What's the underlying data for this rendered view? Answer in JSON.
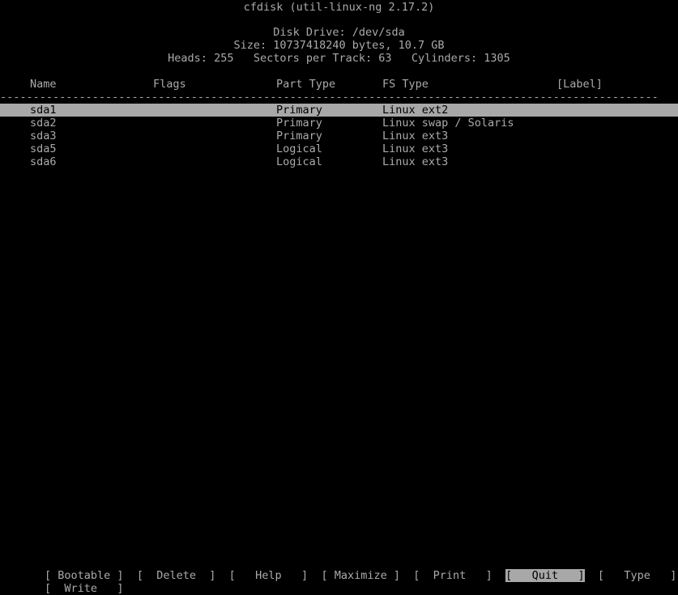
{
  "header": {
    "title": "cfdisk (util-linux-ng 2.17.2)",
    "disk_drive": "Disk Drive: /dev/sda",
    "size": "Size: 10737418240 bytes, 10.7 GB",
    "geometry": "Heads: 255   Sectors per Track: 63   Cylinders: 1305",
    "heads": "255",
    "sectors_per_track": "63",
    "cylinders": "1305",
    "device": "/dev/sda",
    "size_bytes": "10737418240",
    "size_human": "10.7 GB"
  },
  "table": {
    "columns": {
      "name": "Name",
      "flags": "Flags",
      "part_type": "Part Type",
      "fs_type": "FS Type",
      "label": "[Label]"
    },
    "separator": "-------------------------------------------------------------------------------------------------------",
    "rows": [
      {
        "name": "sda1",
        "flags": "",
        "part_type": "Primary",
        "fs_type": "Linux ext2",
        "label": "",
        "selected": true
      },
      {
        "name": "sda2",
        "flags": "",
        "part_type": "Primary",
        "fs_type": "Linux swap / Solaris",
        "label": "",
        "selected": false
      },
      {
        "name": "sda3",
        "flags": "",
        "part_type": "Primary",
        "fs_type": "Linux ext3",
        "label": "",
        "selected": false
      },
      {
        "name": "sda5",
        "flags": "",
        "part_type": "Logical",
        "fs_type": "Linux ext3",
        "label": "",
        "selected": false
      },
      {
        "name": "sda6",
        "flags": "",
        "part_type": "Logical",
        "fs_type": "Linux ext3",
        "label": "",
        "selected": false
      }
    ]
  },
  "menu": {
    "rows": [
      [
        {
          "key": "bootable",
          "text": "[ Bootable ]",
          "selected": false
        },
        {
          "key": "delete",
          "text": "[  Delete  ]",
          "selected": false
        },
        {
          "key": "help",
          "text": "[   Help   ]",
          "selected": false
        },
        {
          "key": "maximize",
          "text": "[ Maximize ]",
          "selected": false
        },
        {
          "key": "print",
          "text": "[  Print   ]",
          "selected": false
        },
        {
          "key": "quit",
          "text": "[   Quit   ]",
          "selected": true
        },
        {
          "key": "type",
          "text": "[   Type   ]",
          "selected": false
        }
      ],
      [
        {
          "key": "write",
          "text": "[  Write   ]",
          "selected": false
        }
      ]
    ],
    "separator": " "
  },
  "colors": {
    "background": "#000000",
    "foreground": "#aaaaaa",
    "highlight_bg": "#a8a8a8",
    "highlight_fg": "#000000"
  }
}
